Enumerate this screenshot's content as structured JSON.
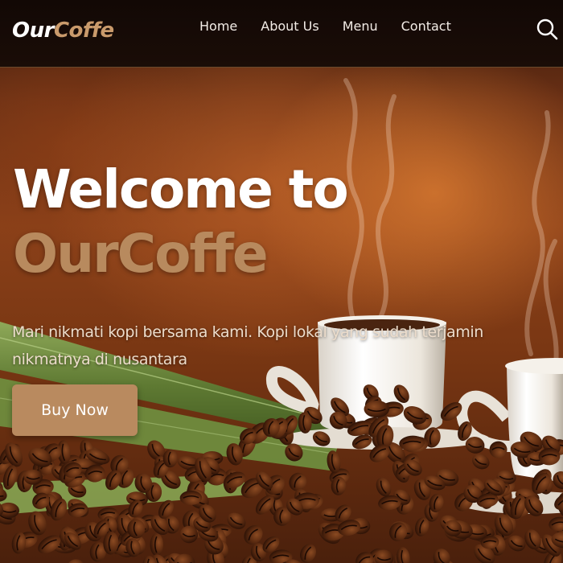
{
  "brand": {
    "part1": "Our",
    "part2": "Coffe"
  },
  "nav": {
    "items": [
      {
        "label": "Home"
      },
      {
        "label": "About Us"
      },
      {
        "label": "Menu"
      },
      {
        "label": "Contact"
      }
    ],
    "search_icon": "search-icon"
  },
  "hero": {
    "title_line1": "Welcome to",
    "title_line2": "OurCoffe",
    "subtitle": "Mari nikmati kopi bersama kami. Kopi lokal yang sudah terjamin nikmatnya di nusantara",
    "cta_label": "Buy Now"
  },
  "colors": {
    "accent": "#b98a5f",
    "brand_light": "#c99a6b",
    "nav_bg": "#130906"
  }
}
